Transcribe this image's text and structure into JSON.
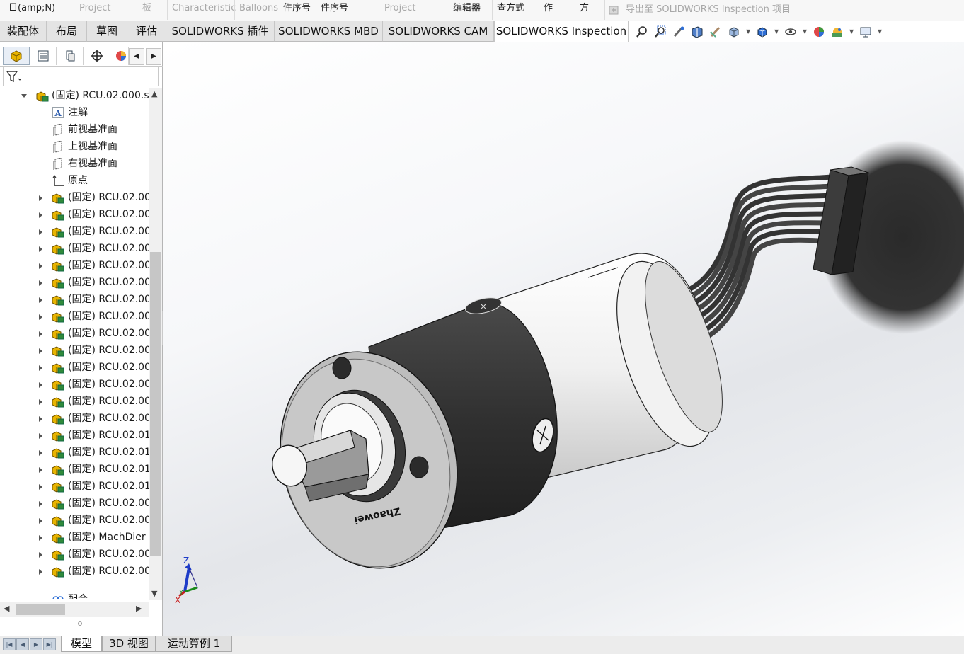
{
  "ribbon_top": {
    "items": [
      {
        "label": "目(amp;N)",
        "dim": false
      },
      {
        "label": "Project",
        "dim": true
      },
      {
        "label": "板",
        "dim": true
      },
      {
        "label": "Characteristic",
        "dim": true
      },
      {
        "label": "Balloons",
        "dim": true
      },
      {
        "label": "件序号",
        "dim": false
      },
      {
        "label": "件序号",
        "dim": false
      },
      {
        "label": "Project",
        "dim": true
      },
      {
        "label": "编辑器",
        "dim": false
      },
      {
        "label": "查方式",
        "dim": false
      },
      {
        "label": "作",
        "dim": false
      },
      {
        "label": "方",
        "dim": false
      },
      {
        "label": "导出至 SOLIDWORKS Inspection 项目",
        "dim": true
      }
    ]
  },
  "tabs": [
    {
      "label": "装配体"
    },
    {
      "label": "布局"
    },
    {
      "label": "草图"
    },
    {
      "label": "评估"
    },
    {
      "label": "SOLIDWORKS 插件"
    },
    {
      "label": "SOLIDWORKS MBD"
    },
    {
      "label": "SOLIDWORKS CAM"
    },
    {
      "label": "SOLIDWORKS Inspection"
    }
  ],
  "view_toolbar_icons": [
    "zoom-to-fit-icon",
    "zoom-area-icon",
    "previous-view-icon",
    "section-view-icon",
    "dynamic-annotation-icon",
    "view-orientation-icon",
    "display-style-icon",
    "hide-show-icon",
    "edit-appearance-icon",
    "apply-scene-icon",
    "view-settings-icon"
  ],
  "panel_tabs": [
    "feature-manager-icon",
    "property-manager-icon",
    "configuration-manager-icon",
    "dimxpert-icon",
    "display-manager-icon"
  ],
  "tree": {
    "root": "(固定) RCU.02.000.s",
    "fixed_items": [
      {
        "label": "注解",
        "icon": "annotations-icon"
      },
      {
        "label": "前视基准面",
        "icon": "plane-icon"
      },
      {
        "label": "上视基准面",
        "icon": "plane-icon"
      },
      {
        "label": "右视基准面",
        "icon": "plane-icon"
      },
      {
        "label": "原点",
        "icon": "origin-icon"
      }
    ],
    "components": [
      "(固定) RCU.02.00",
      "(固定) RCU.02.00",
      "(固定) RCU.02.00",
      "(固定) RCU.02.00",
      "(固定) RCU.02.00",
      "(固定) RCU.02.00",
      "(固定) RCU.02.00",
      "(固定) RCU.02.00",
      "(固定) RCU.02.00",
      "(固定) RCU.02.00",
      "(固定) RCU.02.00",
      "(固定) RCU.02.00",
      "(固定) RCU.02.00",
      "(固定) RCU.02.00",
      "(固定) RCU.02.01",
      "(固定) RCU.02.01",
      "(固定) RCU.02.01",
      "(固定) RCU.02.01",
      "(固定) RCU.02.00",
      "(固定) RCU.02.00",
      "(固定) MachDier",
      "(固定) RCU.02.00",
      "(固定) RCU.02.00"
    ],
    "partial_last": "配合"
  },
  "viewport": {
    "motor_label": "Zhaowei",
    "triad": {
      "x": "X",
      "y": "Y",
      "z": "Z"
    }
  },
  "bottom_tabs": [
    {
      "label": "模型",
      "active": true
    },
    {
      "label": "3D 视图",
      "active": false
    },
    {
      "label": "运动算例 1",
      "active": false
    }
  ],
  "colors": {
    "accent": "#1e64c8",
    "assembly_icon": "#e8b400",
    "motor_dark": "#3a3a3a",
    "motor_light": "#efefef"
  }
}
